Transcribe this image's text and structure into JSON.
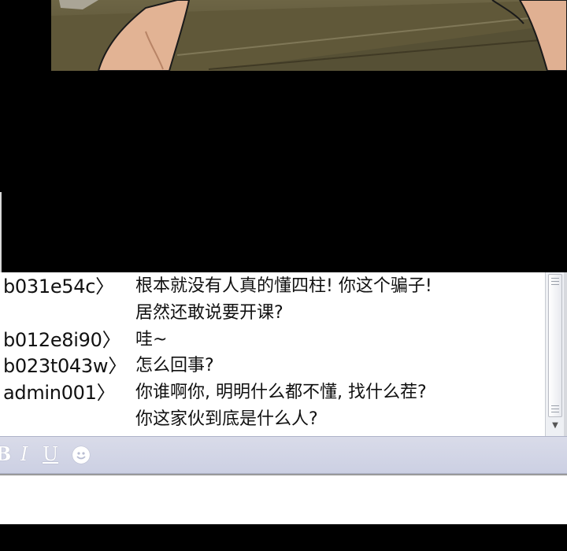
{
  "chat": {
    "messages": [
      {
        "sender": "b031e54c〉",
        "lines": [
          "根本就没有人真的懂四柱! 你这个骗子!",
          "居然还敢说要开课?"
        ]
      },
      {
        "sender": "b012e8i90〉",
        "lines": [
          "哇~"
        ]
      },
      {
        "sender": "b023t043w〉",
        "lines": [
          "怎么回事?"
        ]
      },
      {
        "sender": "admin001〉",
        "lines": [
          "你谁啊你, 明明什么都不懂, 找什么茬?",
          "你这家伙到底是什么人?"
        ]
      }
    ]
  },
  "toolbar": {
    "bold_label": "B",
    "italic_label": "I",
    "underline_label": "U",
    "emoji_icon": "smiley-icon"
  },
  "input": {
    "value": ""
  },
  "colors": {
    "toolbar_bg": "#d0d3e6",
    "chat_bg": "#ffffff",
    "background": "#000000"
  }
}
